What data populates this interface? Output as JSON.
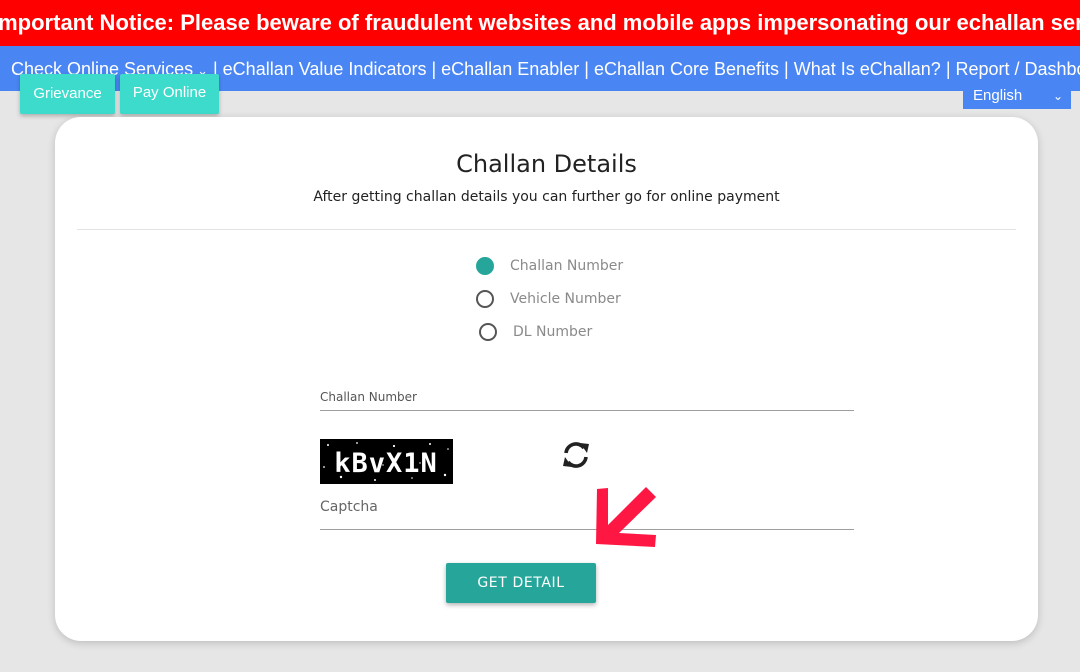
{
  "notice": {
    "text": "Important Notice: Please beware of fraudulent websites and mobile apps impersonating our echallan services. A"
  },
  "nav": {
    "items": [
      {
        "label": "Check Online Services",
        "dropdown": true
      },
      {
        "label": "eChallan Value Indicators"
      },
      {
        "label": "eChallan Enabler"
      },
      {
        "label": "eChallan Core Benefits"
      },
      {
        "label": "What Is eChallan?"
      },
      {
        "label": "Report / Dashboard"
      }
    ],
    "separator": "|",
    "dropdown_icon": "chevron-down-icon"
  },
  "buttons": {
    "grievance": "Grievance",
    "pay_online": "Pay Online"
  },
  "language": {
    "selected": "English",
    "icon": "chevron-down-icon"
  },
  "form": {
    "title": "Challan Details",
    "subtitle": "After getting challan details you can further go for online payment",
    "search_by": [
      {
        "label": "Challan Number",
        "checked": true
      },
      {
        "label": "Vehicle Number",
        "checked": false
      },
      {
        "label": "DL Number",
        "checked": false
      }
    ],
    "challan_field_label": "Challan Number",
    "challan_value": "",
    "captcha_text": "kBvX1N",
    "captcha_placeholder": "Captcha",
    "refresh_icon": "refresh-icon",
    "submit_label": "GET DETAIL"
  },
  "annotation": {
    "icon": "arrow-annotation-icon"
  },
  "colors": {
    "notice_bg": "#ff0000",
    "navbar_bg": "#4a86f3",
    "accent_teal": "#26a69a",
    "nav_button_bg": "#3ddbcb",
    "annotation_arrow": "#ff1744",
    "page_bg": "#e5e6e5"
  }
}
